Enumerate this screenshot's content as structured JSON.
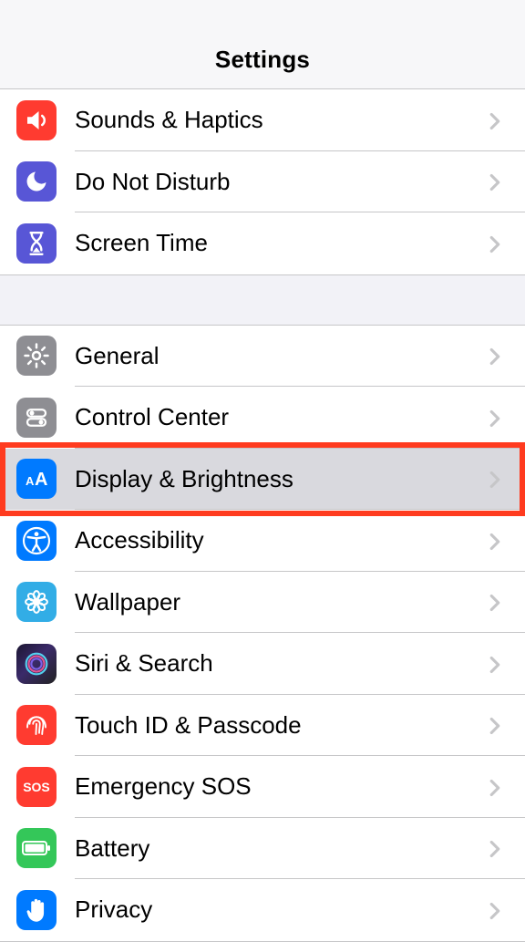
{
  "header": {
    "title": "Settings"
  },
  "groups": [
    {
      "rows": [
        {
          "id": "sounds",
          "label": "Sounds & Haptics"
        },
        {
          "id": "dnd",
          "label": "Do Not Disturb"
        },
        {
          "id": "screentime",
          "label": "Screen Time"
        }
      ]
    },
    {
      "rows": [
        {
          "id": "general",
          "label": "General"
        },
        {
          "id": "controlcenter",
          "label": "Control Center"
        },
        {
          "id": "display",
          "label": "Display & Brightness",
          "highlighted": true
        },
        {
          "id": "accessibility",
          "label": "Accessibility"
        },
        {
          "id": "wallpaper",
          "label": "Wallpaper"
        },
        {
          "id": "siri",
          "label": "Siri & Search"
        },
        {
          "id": "touchid",
          "label": "Touch ID & Passcode"
        },
        {
          "id": "sos",
          "label": "Emergency SOS"
        },
        {
          "id": "battery",
          "label": "Battery"
        },
        {
          "id": "privacy",
          "label": "Privacy"
        }
      ]
    }
  ]
}
